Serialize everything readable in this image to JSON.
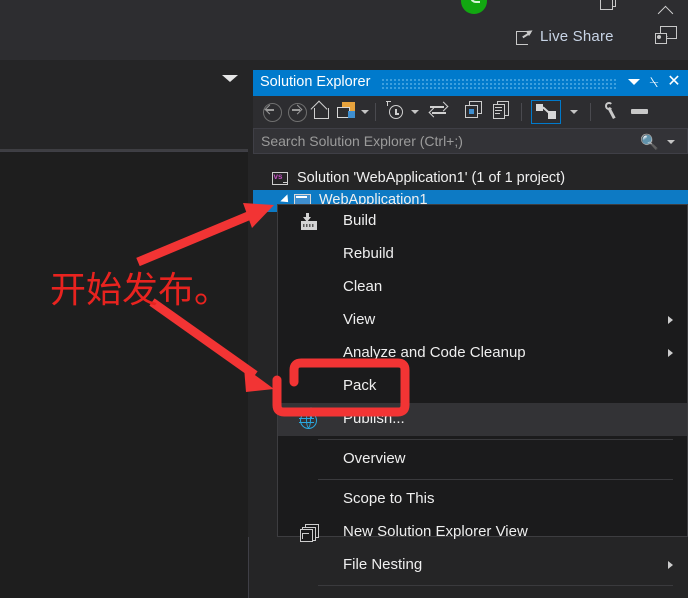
{
  "window": {
    "status_icons": [
      "restore-icon",
      "chevron-up-icon",
      "green-notification-badge"
    ],
    "live_share_label": "Live Share",
    "feedback_icon": "feedback-icon"
  },
  "solution_explorer": {
    "title": "Solution Explorer",
    "title_bar_color": "#007acc",
    "title_buttons": {
      "dropdown": "▼",
      "pin": "⍀",
      "close": "✕"
    },
    "toolbar_icons": [
      "back-icon",
      "forward-icon",
      "home-icon",
      "sync-with-active-document-icon",
      "sync-dropdown-caret",
      "pending-changes-clock-icon",
      "pending-changes-caret",
      "refresh-icon",
      "collapse-all-icon",
      "show-all-files-icon",
      "properties-nav-icon",
      "properties-nav-caret",
      "properties-wrench-icon",
      "properties-window-icon"
    ],
    "search": {
      "placeholder": "Search Solution Explorer (Ctrl+;)",
      "search_icon": "magnifier-icon",
      "dropdown_icon": "chevron-down-icon"
    },
    "tree": [
      {
        "label": "Solution 'WebApplication1' (1 of 1 project)",
        "icon": "solution-icon",
        "selected": false,
        "indent": 0
      },
      {
        "label": "WebApplication1",
        "icon": "project-icon",
        "selected": true,
        "indent": 1
      }
    ]
  },
  "context_menu": {
    "items": [
      {
        "label": "Build",
        "icon": "build-icon",
        "submenu": false,
        "highlighted": false,
        "separator_after": false
      },
      {
        "label": "Rebuild",
        "icon": "",
        "submenu": false,
        "highlighted": false,
        "separator_after": false
      },
      {
        "label": "Clean",
        "icon": "",
        "submenu": false,
        "highlighted": false,
        "separator_after": false
      },
      {
        "label": "View",
        "icon": "",
        "submenu": true,
        "highlighted": false,
        "separator_after": false
      },
      {
        "label": "Analyze and Code Cleanup",
        "icon": "",
        "submenu": true,
        "highlighted": false,
        "separator_after": false
      },
      {
        "label": "Pack",
        "icon": "",
        "submenu": false,
        "highlighted": false,
        "separator_after": false
      },
      {
        "label": "Publish...",
        "icon": "publish-globe-icon",
        "submenu": false,
        "highlighted": true,
        "separator_after": true
      },
      {
        "label": "Overview",
        "icon": "",
        "submenu": false,
        "highlighted": false,
        "separator_after": true
      },
      {
        "label": "Scope to This",
        "icon": "",
        "submenu": false,
        "highlighted": false,
        "separator_after": false
      },
      {
        "label": "New Solution Explorer View",
        "icon": "new-solution-explorer-view-icon",
        "submenu": false,
        "highlighted": false,
        "separator_after": false
      },
      {
        "label": "File Nesting",
        "icon": "",
        "submenu": true,
        "highlighted": false,
        "separator_after": true
      }
    ]
  },
  "annotation": {
    "text": "开始发布。",
    "color": "#e8231f",
    "arrows": 2,
    "highlight_shape": "rounded-rectangle-around-publish"
  }
}
